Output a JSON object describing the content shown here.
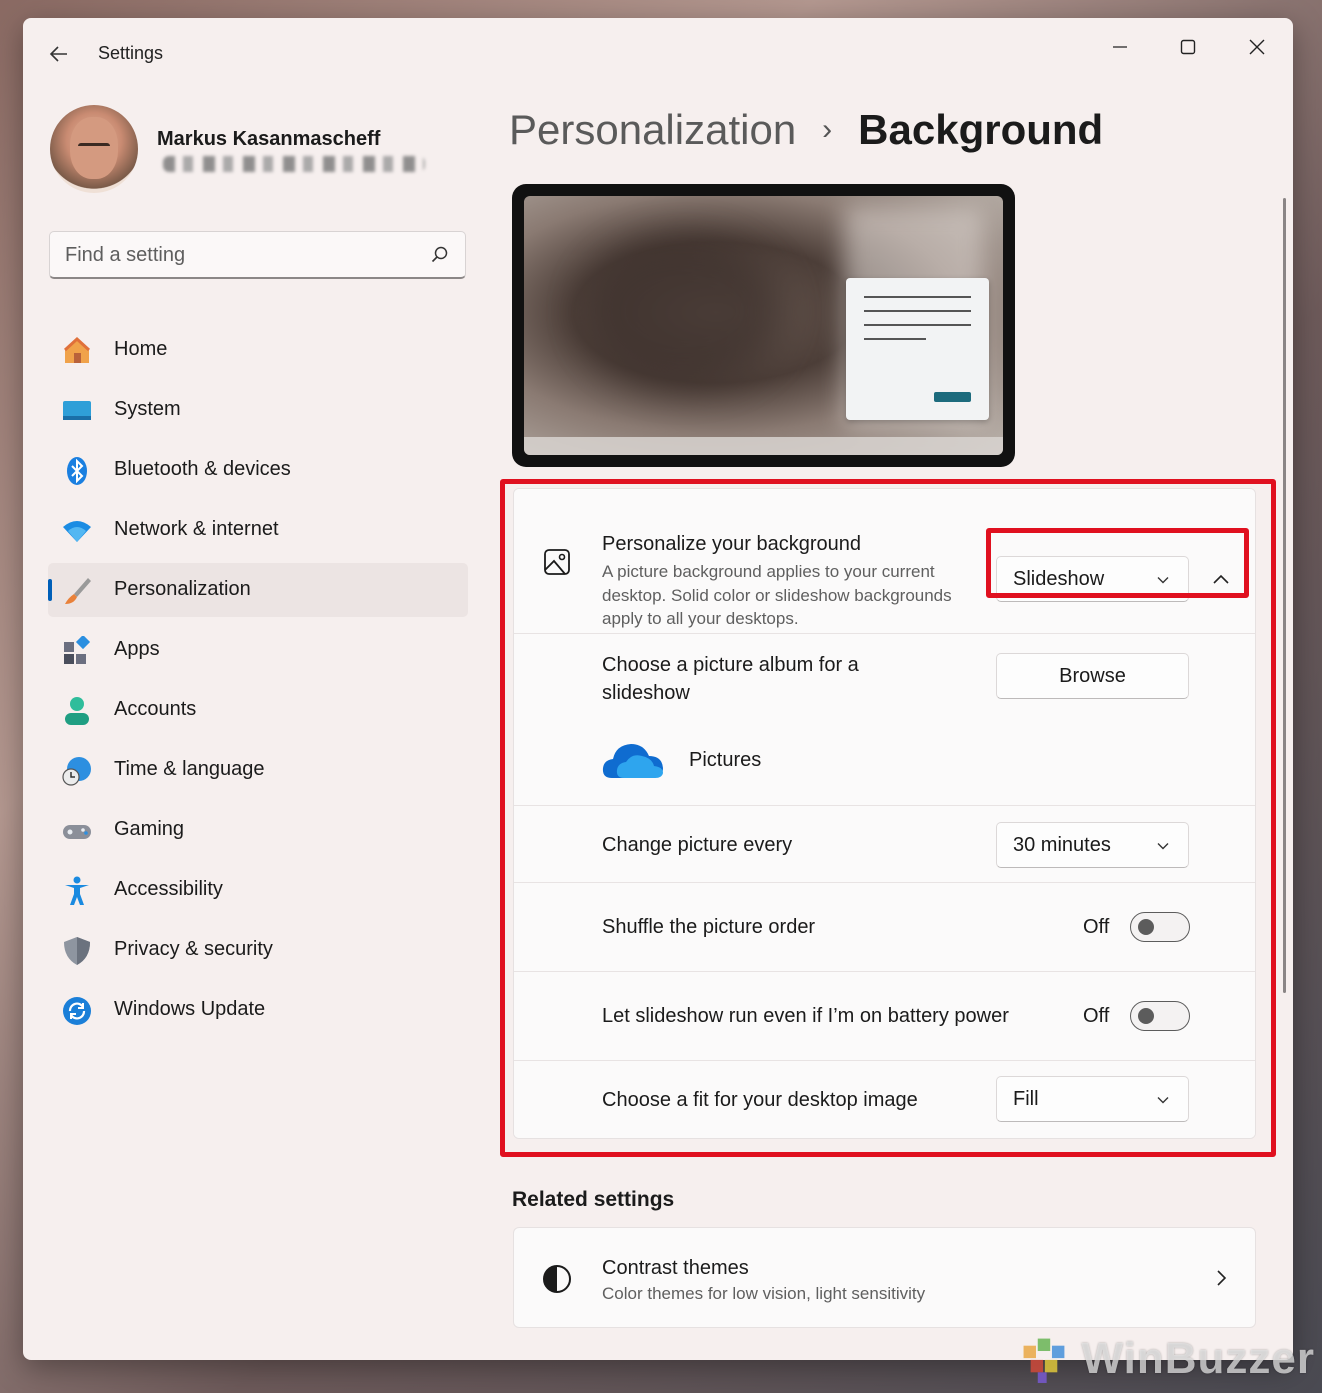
{
  "window": {
    "app_title": "Settings"
  },
  "user": {
    "name": "Markus Kasanmascheff"
  },
  "search": {
    "placeholder": "Find a setting"
  },
  "sidebar": {
    "items": [
      {
        "label": "Home",
        "icon": "home-icon"
      },
      {
        "label": "System",
        "icon": "system-icon"
      },
      {
        "label": "Bluetooth & devices",
        "icon": "bluetooth-icon"
      },
      {
        "label": "Network & internet",
        "icon": "wifi-icon"
      },
      {
        "label": "Personalization",
        "icon": "brush-icon",
        "active": true
      },
      {
        "label": "Apps",
        "icon": "apps-icon"
      },
      {
        "label": "Accounts",
        "icon": "accounts-icon"
      },
      {
        "label": "Time & language",
        "icon": "globe-clock-icon"
      },
      {
        "label": "Gaming",
        "icon": "gamepad-icon"
      },
      {
        "label": "Accessibility",
        "icon": "accessibility-icon"
      },
      {
        "label": "Privacy & security",
        "icon": "shield-icon"
      },
      {
        "label": "Windows Update",
        "icon": "update-icon"
      }
    ]
  },
  "breadcrumb": {
    "parent": "Personalization",
    "separator": "›",
    "current": "Background"
  },
  "background": {
    "personalize": {
      "title": "Personalize your background",
      "description": "A picture background applies to your current desktop. Solid color or slideshow backgrounds apply to all your desktops.",
      "value": "Slideshow"
    },
    "album": {
      "title": "Choose a picture album for a slideshow",
      "button": "Browse",
      "folder": "Pictures"
    },
    "interval": {
      "title": "Change picture every",
      "value": "30 minutes"
    },
    "shuffle": {
      "title": "Shuffle the picture order",
      "state": "Off"
    },
    "battery": {
      "title": "Let slideshow run even if I’m on battery power",
      "state": "Off"
    },
    "fit": {
      "title": "Choose a fit for your desktop image",
      "value": "Fill"
    }
  },
  "related": {
    "heading": "Related settings",
    "contrast": {
      "title": "Contrast themes",
      "description": "Color themes for low vision, light sensitivity"
    }
  },
  "watermark": {
    "text": "WinBuzzer"
  },
  "colors": {
    "accent": "#005fb8",
    "highlight": "#e0101f",
    "window_bg": "#f6efee"
  }
}
